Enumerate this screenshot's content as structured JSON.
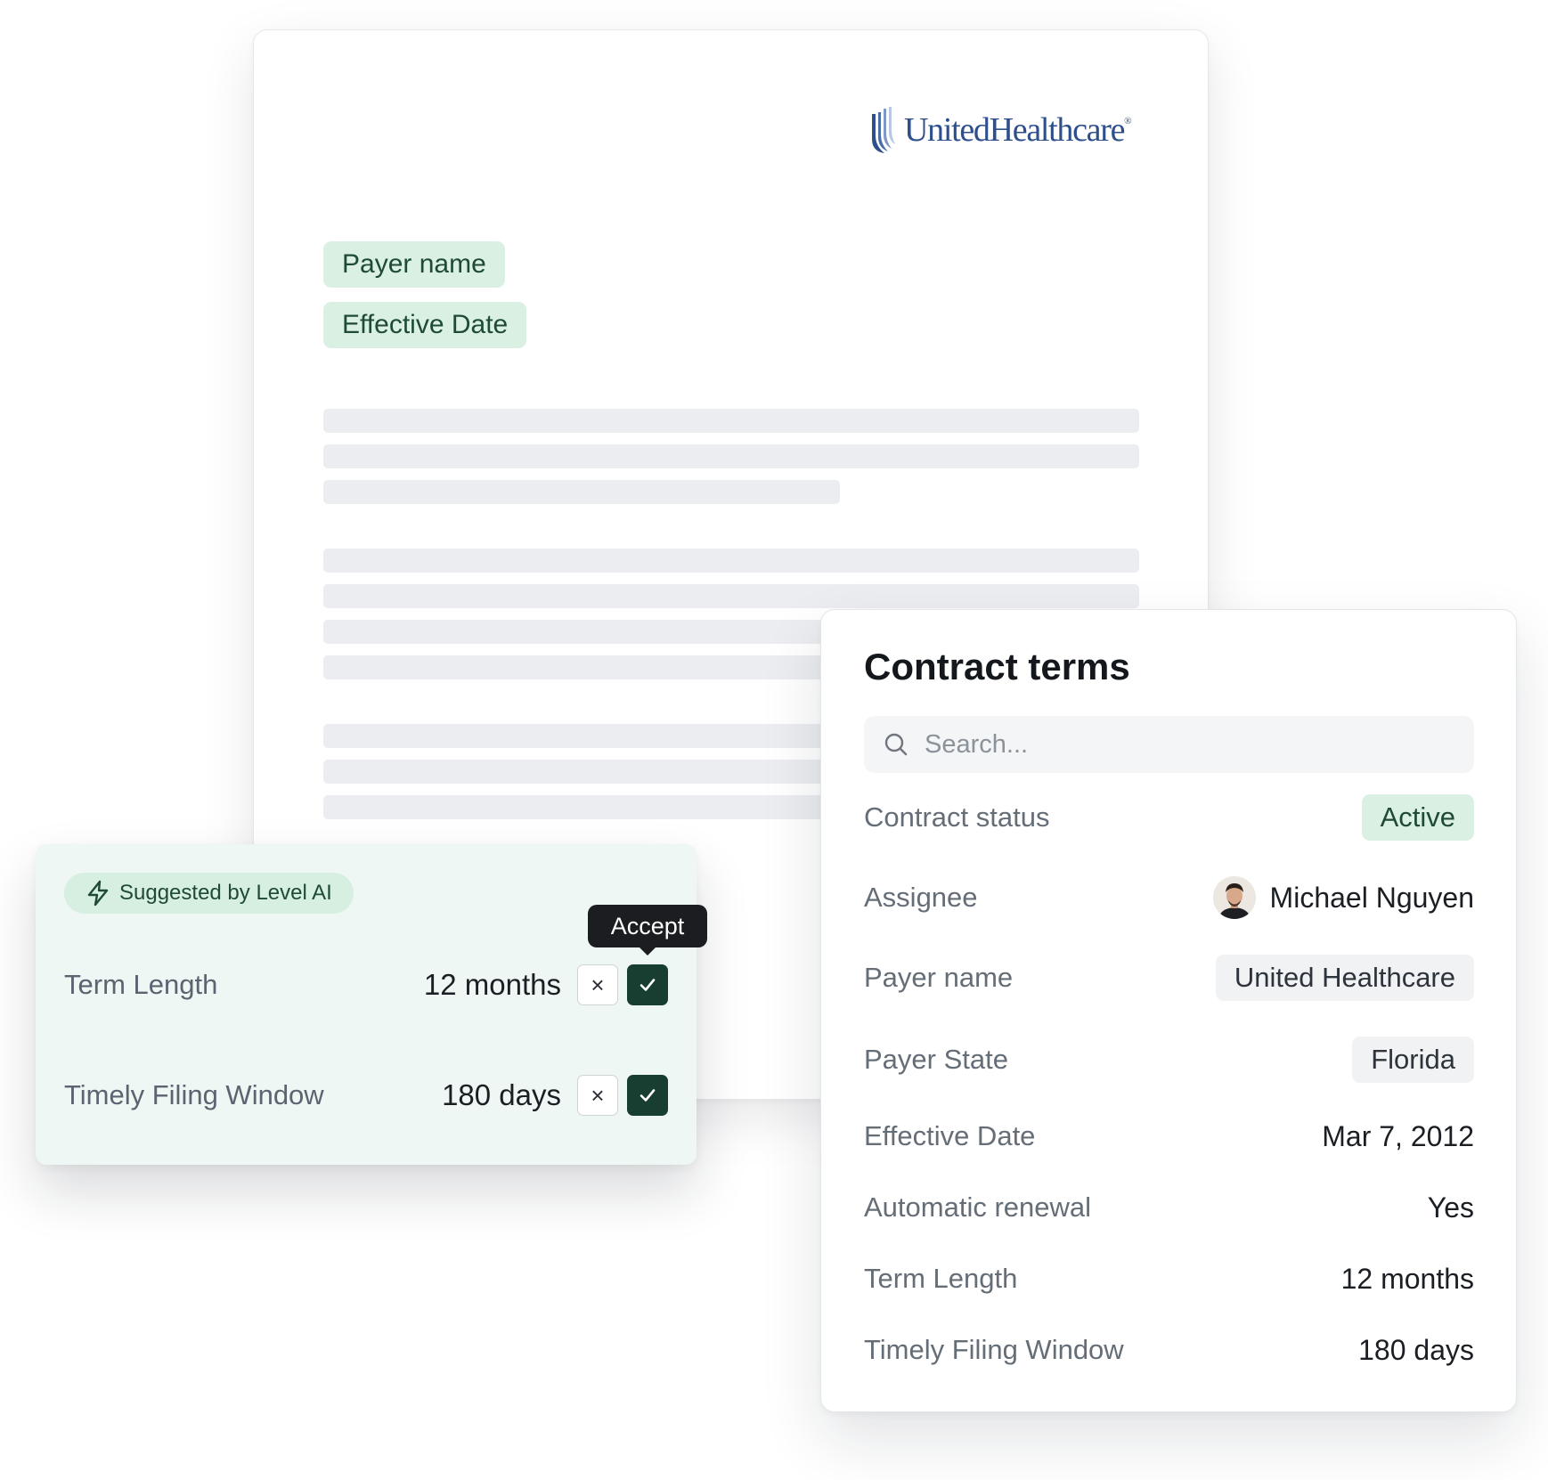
{
  "document": {
    "logo_text": "UnitedHealthcare",
    "tags": {
      "payer_name": "Payer name",
      "effective_date": "Effective Date"
    }
  },
  "suggestion": {
    "badge_label": "Suggested by Level AI",
    "tooltip": "Accept",
    "rows": [
      {
        "label": "Term Length",
        "value": "12 months"
      },
      {
        "label": "Timely Filing Window",
        "value": "180 days"
      }
    ],
    "reject_symbol": "×",
    "accent_color": "#183d31"
  },
  "panel": {
    "title": "Contract terms",
    "search_placeholder": "Search...",
    "rows": [
      {
        "label": "Contract status",
        "value": "Active"
      },
      {
        "label": "Assignee",
        "value": "Michael Nguyen"
      },
      {
        "label": "Payer name",
        "value": "United Healthcare"
      },
      {
        "label": "Payer State",
        "value": "Florida"
      },
      {
        "label": "Effective Date",
        "value": "Mar 7, 2012"
      },
      {
        "label": "Automatic renewal",
        "value": "Yes"
      },
      {
        "label": "Term Length",
        "value": "12 months"
      },
      {
        "label": "Timely Filing Window",
        "value": "180 days"
      }
    ]
  },
  "colors": {
    "tag_bg": "#d9f0e2",
    "tag_text": "#1f4a36",
    "logo_blue": "#2d4f8b"
  }
}
